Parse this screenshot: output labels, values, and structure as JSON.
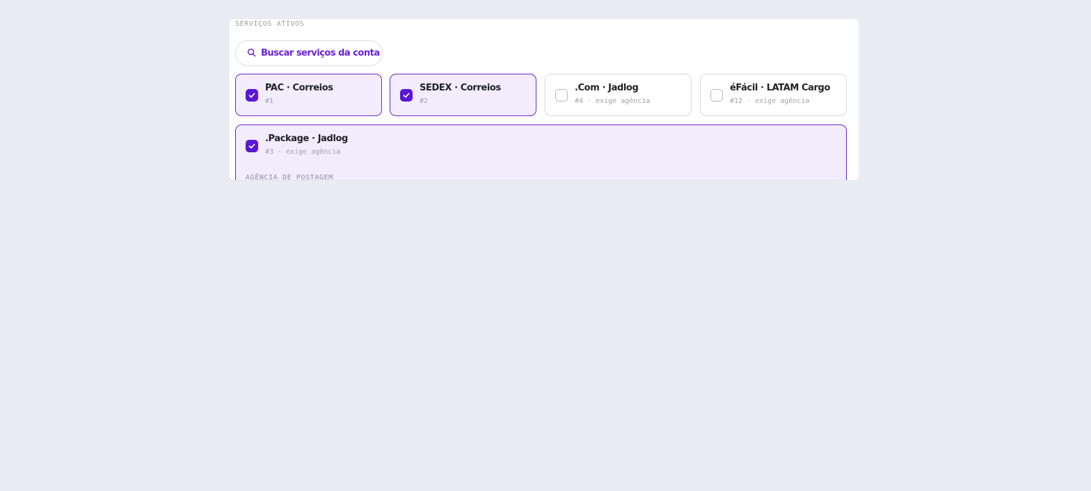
{
  "section_title": "SERVIÇOS ATIVOS",
  "search": {
    "label": "Buscar serviços da conta",
    "icon": "search-icon"
  },
  "services": [
    {
      "title": "PAC · Correios",
      "meta": "#1",
      "checked": true
    },
    {
      "title": "SEDEX · Correios",
      "meta": "#2",
      "checked": true
    },
    {
      "title": ".Com · Jadlog",
      "meta": "#4 · exige agência",
      "checked": false
    },
    {
      "title": "éFácil · LATAM Cargo",
      "meta": "#12 · exige agência",
      "checked": false
    }
  ],
  "expanded_service": {
    "title": ".Package · Jadlog",
    "meta": "#3 · exige agência",
    "checked": true,
    "agency_label": "AGÊNCIA DE POSTAGEM"
  },
  "colors": {
    "accent": "#5b16d6",
    "accent_text": "#6a1fd6",
    "selected_bg": "#f3ecfc",
    "selected_border": "#6a29c2",
    "page_bg": "#e9ecf1"
  }
}
